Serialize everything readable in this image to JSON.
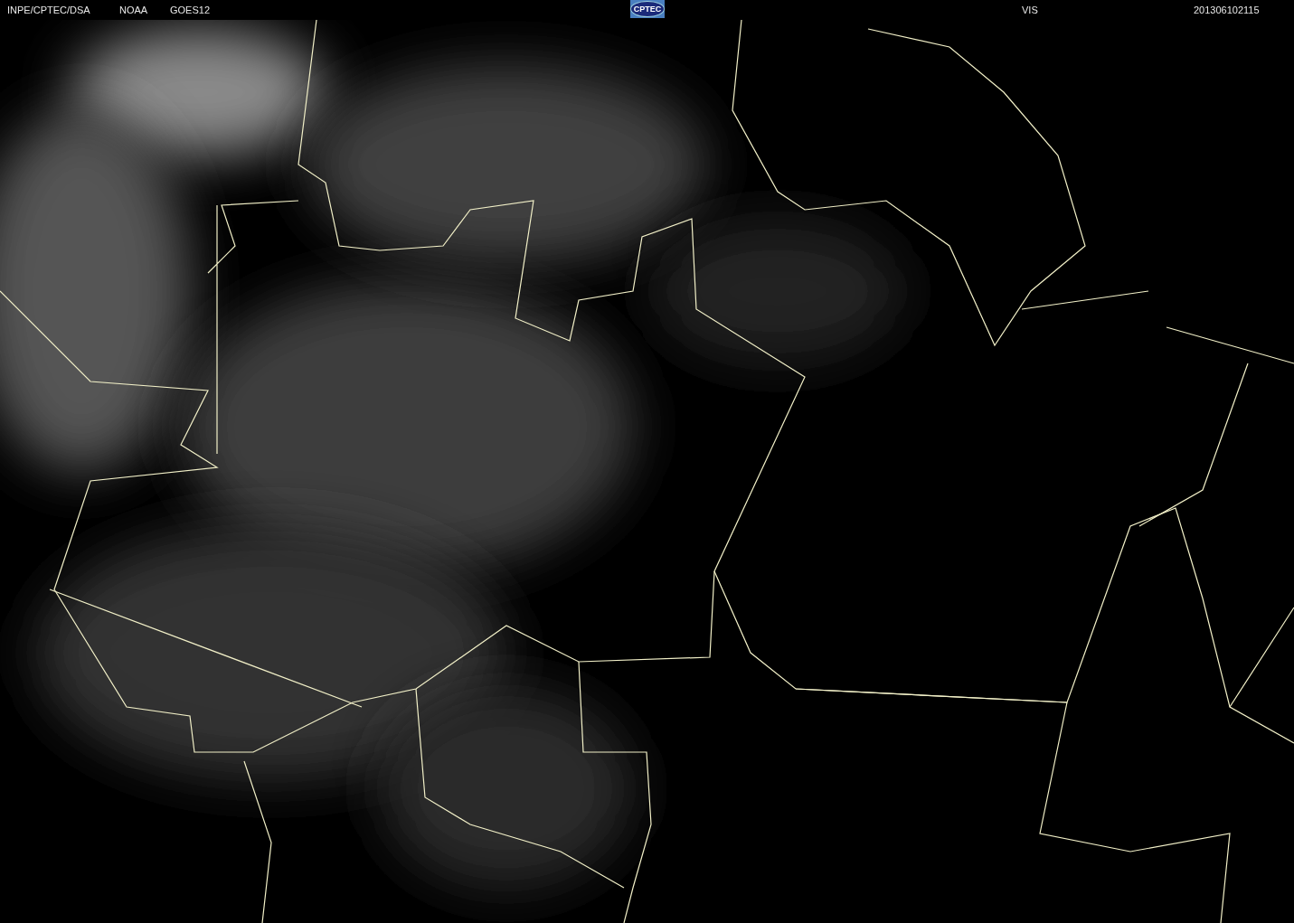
{
  "header": {
    "source": "INPE/CPTEC/DSA",
    "agency": "NOAA",
    "satellite": "GOES12",
    "logo": "CPTEC",
    "channel": "VIS",
    "timestamp": "201306102115"
  }
}
